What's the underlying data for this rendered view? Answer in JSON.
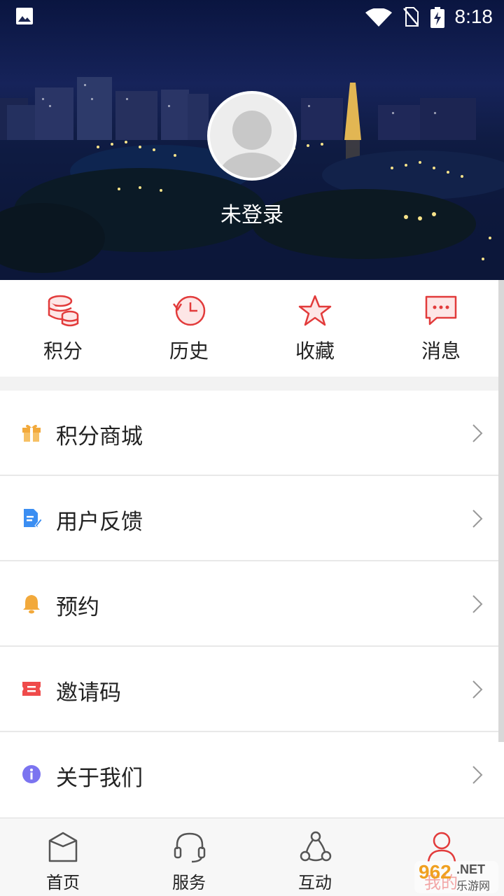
{
  "status_bar": {
    "time": "8:18"
  },
  "profile": {
    "login_status": "未登录"
  },
  "quick_actions": [
    {
      "label": "积分",
      "icon": "coins-icon"
    },
    {
      "label": "历史",
      "icon": "history-icon"
    },
    {
      "label": "收藏",
      "icon": "star-icon"
    },
    {
      "label": "消息",
      "icon": "message-icon"
    }
  ],
  "menu": [
    {
      "label": "积分商城",
      "icon": "gift-icon",
      "color": "#f2a93b"
    },
    {
      "label": "用户反馈",
      "icon": "feedback-icon",
      "color": "#3b8ef2"
    },
    {
      "label": "预约",
      "icon": "bell-icon",
      "color": "#f2a93b"
    },
    {
      "label": "邀请码",
      "icon": "ticket-icon",
      "color": "#ef4b4b"
    },
    {
      "label": "关于我们",
      "icon": "info-icon",
      "color": "#7b74f0"
    }
  ],
  "bottom_nav": [
    {
      "label": "首页",
      "icon": "home-icon"
    },
    {
      "label": "服务",
      "icon": "headset-icon"
    },
    {
      "label": "互动",
      "icon": "interaction-icon"
    },
    {
      "label": "我的",
      "icon": "user-icon",
      "active": true
    }
  ],
  "watermark": {
    "brand": "962",
    "domain": ".NET",
    "site": "乐游网"
  },
  "colors": {
    "accent": "#e23b3b",
    "text": "#222222",
    "divider": "#e8e8e8"
  }
}
